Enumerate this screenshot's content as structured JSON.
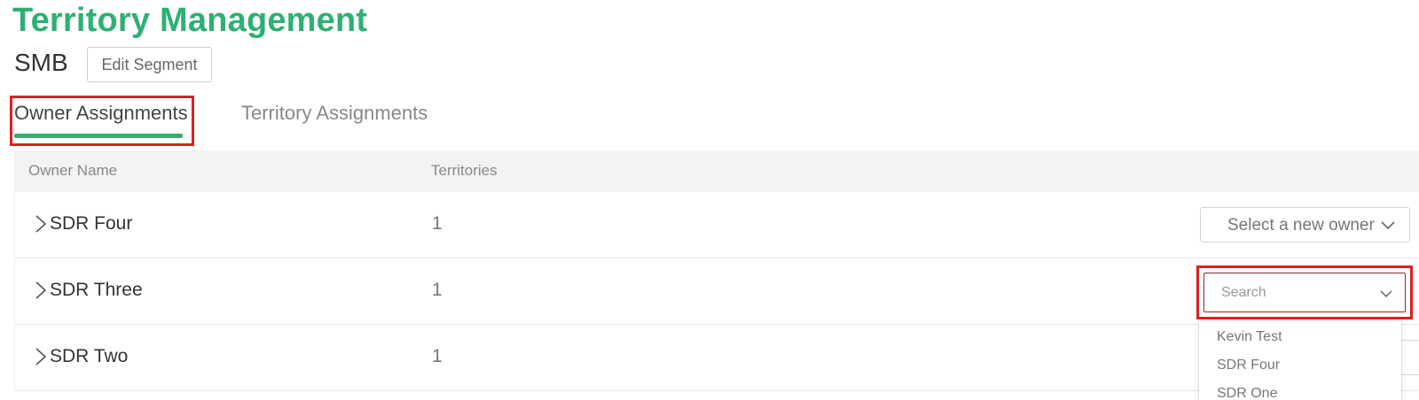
{
  "header": {
    "title": "Territory Management",
    "segment": "SMB",
    "edit_label": "Edit Segment"
  },
  "tabs": [
    {
      "label": "Owner Assignments",
      "active": true
    },
    {
      "label": "Territory Assignments",
      "active": false
    }
  ],
  "table": {
    "columns": [
      "Owner Name",
      "Territories"
    ],
    "rows": [
      {
        "owner": "SDR Four",
        "territories": "1",
        "action": "Select a new owner"
      },
      {
        "owner": "SDR Three",
        "territories": "1"
      },
      {
        "owner": "SDR Two",
        "territories": "1"
      }
    ]
  },
  "search": {
    "placeholder": "Search"
  },
  "dropdown": {
    "options": [
      "Kevin Test",
      "SDR Four",
      "SDR One"
    ]
  },
  "colors": {
    "accent": "#2eb073",
    "highlight": "#e02020"
  },
  "icons": {
    "expand": "chevron-right-icon",
    "select": "chevron-down-icon"
  }
}
